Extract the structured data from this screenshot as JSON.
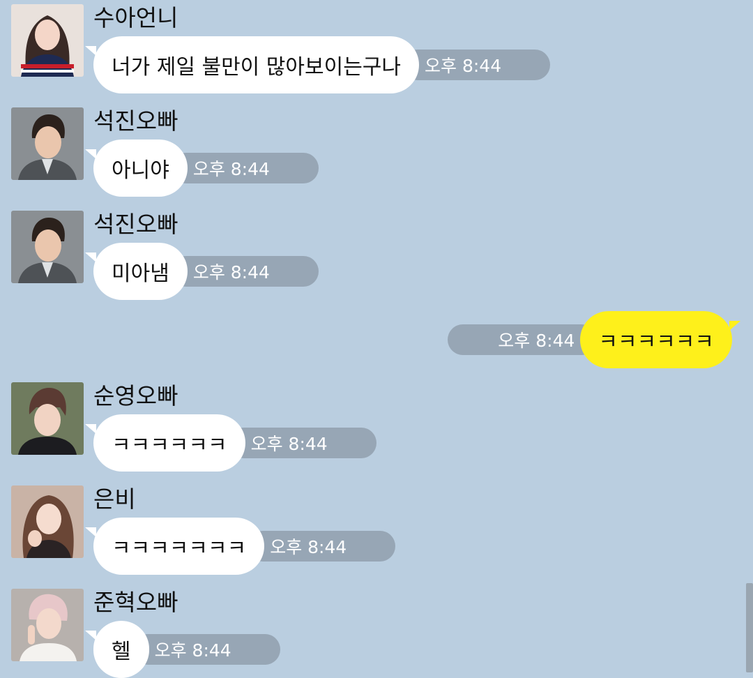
{
  "chat": {
    "messages": [
      {
        "sender": "수아언니",
        "text": "너가 제일 불만이 많아보이는구나",
        "time": "오후 8:44",
        "avatar_icon": "profile-photo-sua"
      },
      {
        "sender": "석진오빠",
        "text": "아니야",
        "time": "오후 8:44",
        "avatar_icon": "profile-photo-seokjin"
      },
      {
        "sender": "석진오빠",
        "text": "미아냄",
        "time": "오후 8:44",
        "avatar_icon": "profile-photo-seokjin"
      },
      {
        "sender": "",
        "text": "ㅋㅋㅋㅋㅋㅋ",
        "time": "오후 8:44",
        "outgoing": true
      },
      {
        "sender": "순영오빠",
        "text": "ㅋㅋㅋㅋㅋㅋ",
        "time": "오후 8:44",
        "avatar_icon": "profile-photo-sunyoung"
      },
      {
        "sender": "은비",
        "text": "ㅋㅋㅋㅋㅋㅋㅋ",
        "time": "오후 8:44",
        "avatar_icon": "profile-photo-eunbi"
      },
      {
        "sender": "준혁오빠",
        "text": "헬",
        "time": "오후 8:44",
        "avatar_icon": "profile-photo-junhyuk"
      }
    ]
  },
  "colors": {
    "background": "#bacee0",
    "incoming_bubble": "#ffffff",
    "outgoing_bubble": "#fef01b",
    "time_pill": "#97a6b5"
  }
}
